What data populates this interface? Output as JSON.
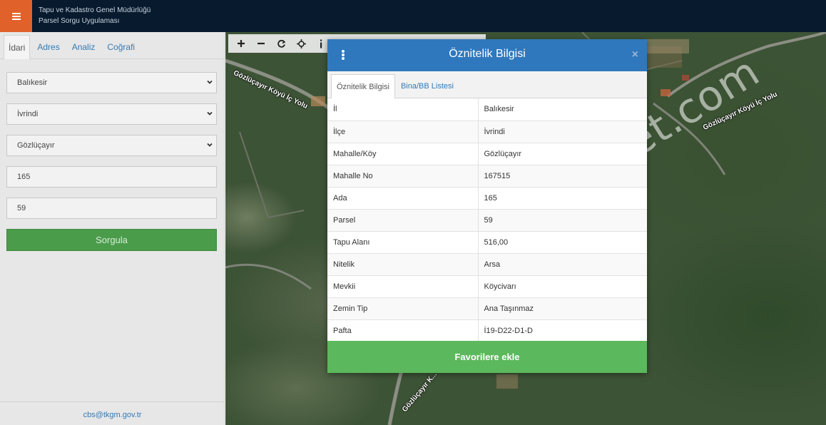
{
  "header": {
    "title_line1": "Tapu ve Kadastro Genel Müdürlüğü",
    "title_line2": "Parsel Sorgu Uygulaması",
    "accent_color": "#e0612a"
  },
  "sidebar": {
    "tabs": [
      {
        "label": "İdari",
        "active": true
      },
      {
        "label": "Adres",
        "active": false
      },
      {
        "label": "Analiz",
        "active": false
      },
      {
        "label": "Coğrafi",
        "active": false
      }
    ],
    "il_select": "Balıkesir",
    "ilce_select": "İvrindi",
    "mahalle_select": "Gözlüçayır",
    "ada_input": "165",
    "parsel_input": "59",
    "submit_label": "Sorgula",
    "contact_email": "cbs@tkgm.gov.tr"
  },
  "map": {
    "road_labels": [
      "Gözlüçayır Köyü İç Yolu",
      "Gözlüçayır Köyü İç Yolu",
      "Gözlüçayır K..."
    ],
    "toolbar_icons": [
      "plus-icon",
      "minus-icon",
      "refresh-icon",
      "crosshair-icon",
      "info-icon"
    ],
    "watermark": "emlakjet.com"
  },
  "modal": {
    "title": "Öznitelik Bilgisi",
    "close": "×",
    "tabs": [
      {
        "label": "Öznitelik Bilgisi",
        "active": true
      },
      {
        "label": "Bina/BB Listesi",
        "active": false
      }
    ],
    "rows": [
      {
        "key": "İl",
        "value": "Balıkesir"
      },
      {
        "key": "İlçe",
        "value": "İvrindi"
      },
      {
        "key": "Mahalle/Köy",
        "value": "Gözlüçayır"
      },
      {
        "key": "Mahalle No",
        "value": "167515"
      },
      {
        "key": "Ada",
        "value": "165"
      },
      {
        "key": "Parsel",
        "value": "59"
      },
      {
        "key": "Tapu Alanı",
        "value": "516,00"
      },
      {
        "key": "Nitelik",
        "value": "Arsa"
      },
      {
        "key": "Mevkii",
        "value": "Köycivarı"
      },
      {
        "key": "Zemin Tip",
        "value": "Ana Taşınmaz"
      },
      {
        "key": "Pafta",
        "value": "İ19-D22-D1-D"
      }
    ],
    "favorite_label": "Favorilere ekle",
    "header_color": "#2f78bd",
    "button_color": "#5cb85c"
  }
}
